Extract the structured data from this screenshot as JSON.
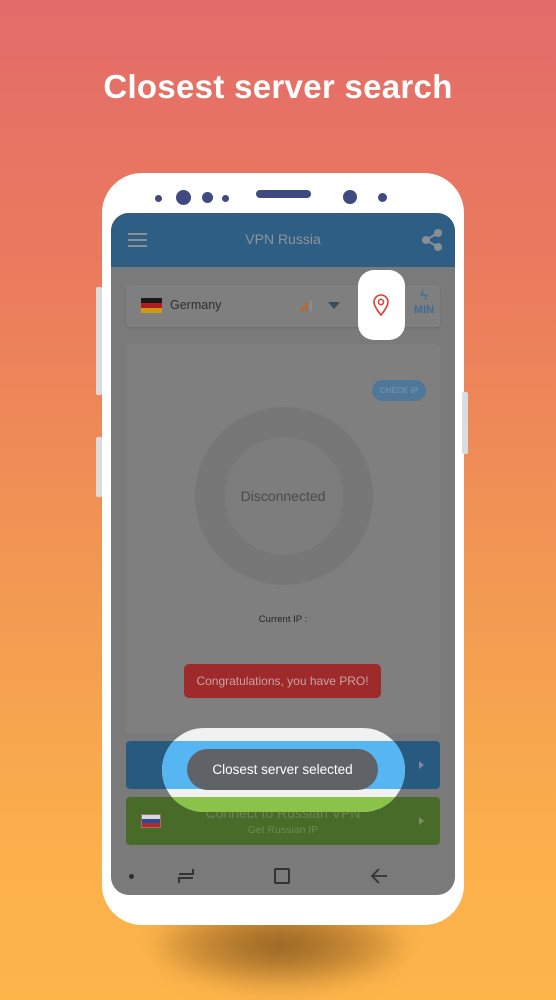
{
  "promo": {
    "headline": "Closest server search"
  },
  "app": {
    "title": "VPN Russia",
    "icons": {
      "menu": "hamburger-menu-icon",
      "share": "share-icon"
    }
  },
  "server_selector": {
    "country": "Germany",
    "flag": "germany-flag",
    "signal": "signal-strength-icon",
    "dropdown": "chevron-down-icon",
    "locate_icon": "location-pin-icon",
    "mode_icon": "lightning-bolt-icon",
    "mode_label": "MIN"
  },
  "status_card": {
    "check_ip_label": "CHECK IP",
    "connection_status": "Disconnected",
    "current_ip_label": "Current IP :",
    "pro_badge": "Congratulations, you have PRO!"
  },
  "buttons": {
    "russia_title": "Connect to Russian VPN",
    "russia_subtitle": "Get Russian IP",
    "russia_flag": "russia-flag"
  },
  "toast": {
    "message": "Closest server selected"
  },
  "colors": {
    "appbar": "#2e5e84",
    "accent_pin": "#e53935",
    "pro_badge": "#9e2a2b",
    "fast_button": "#285a80",
    "russia_button": "#486b29",
    "highlight_blue": "#55b6f2",
    "highlight_green": "#8bc34a",
    "toast": "#5f6368"
  }
}
